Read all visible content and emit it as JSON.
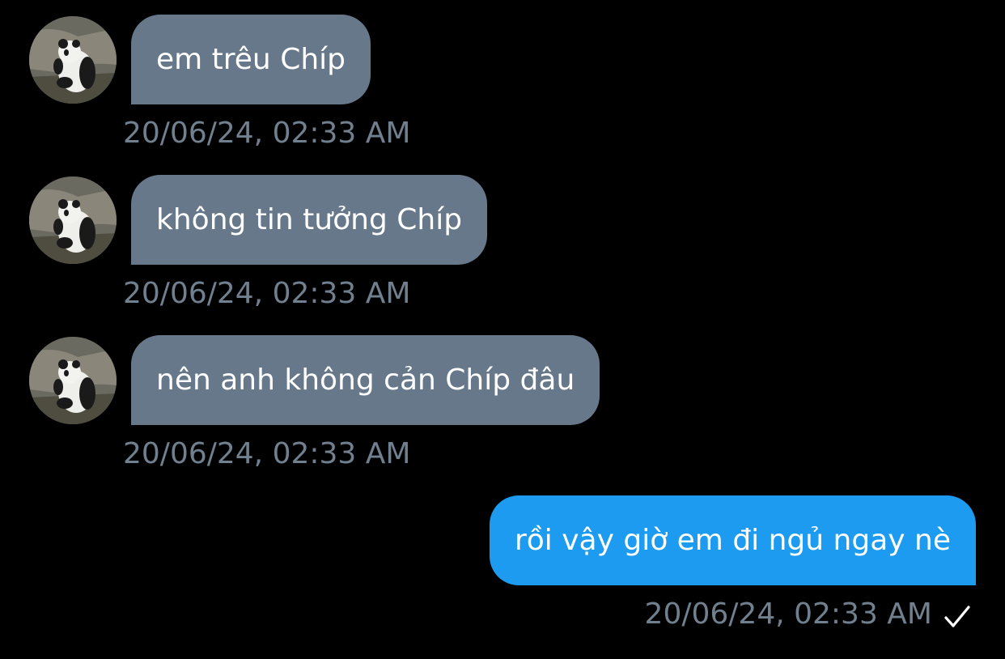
{
  "messages": [
    {
      "direction": "incoming",
      "text": "em trêu Chíp",
      "timestamp": "20/06/24, 02:33 AM"
    },
    {
      "direction": "incoming",
      "text": "không tin tưởng Chíp",
      "timestamp": "20/06/24, 02:33 AM"
    },
    {
      "direction": "incoming",
      "text": "nên anh không cản Chíp đâu",
      "timestamp": "20/06/24, 02:33 AM"
    },
    {
      "direction": "outgoing",
      "text": "rồi vậy giờ em đi ngủ ngay nè",
      "timestamp": "20/06/24, 02:33 AM",
      "status_icon": "checkmark-icon"
    }
  ],
  "avatar_icon": "panda-avatar",
  "colors": {
    "background": "#000000",
    "incoming_bubble": "#66788a",
    "outgoing_bubble": "#1d9bf0",
    "timestamp": "#71808f",
    "text": "#ffffff"
  }
}
